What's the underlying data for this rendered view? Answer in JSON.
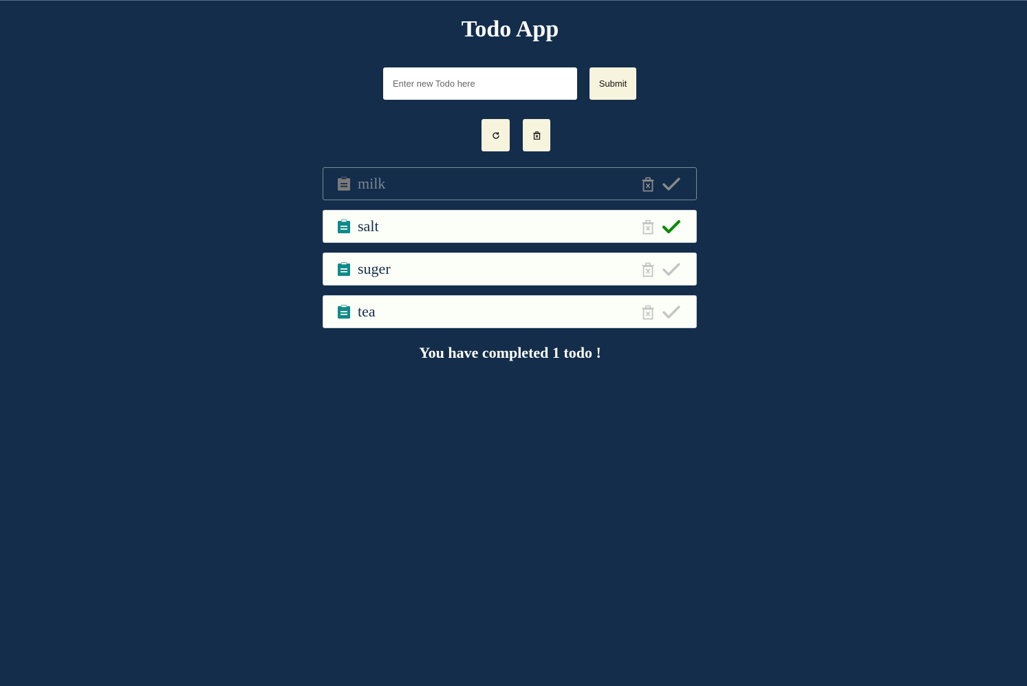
{
  "app": {
    "title": "Todo App"
  },
  "form": {
    "input_value": "",
    "input_placeholder": "Enter new Todo here",
    "submit_label": "Submit"
  },
  "toolbar": {
    "refresh_icon": "refresh-icon",
    "clear_icon": "trash-icon"
  },
  "todos": [
    {
      "text": "milk",
      "completed": false,
      "highlighted": true,
      "icon": "clipboard-icon"
    },
    {
      "text": "salt",
      "completed": true,
      "highlighted": false,
      "icon": "clipboard-icon"
    },
    {
      "text": "suger",
      "completed": false,
      "highlighted": false,
      "icon": "clipboard-icon"
    },
    {
      "text": "tea",
      "completed": false,
      "highlighted": false,
      "icon": "clipboard-icon"
    }
  ],
  "summary": {
    "text": "You have completed 1 todo !"
  },
  "colors": {
    "background": "#132d4b",
    "button_bg": "#f7f4dd",
    "item_bg": "#fcfff7",
    "doc_icon": "#0f8a8a",
    "doc_icon_muted": "#7a7a7a",
    "check_done": "#0a8a0a",
    "check_idle": "#c4c4c4",
    "check_muted": "#8a8a8a",
    "trash_idle": "#c4c4c4",
    "trash_muted": "#8a8a8a"
  }
}
